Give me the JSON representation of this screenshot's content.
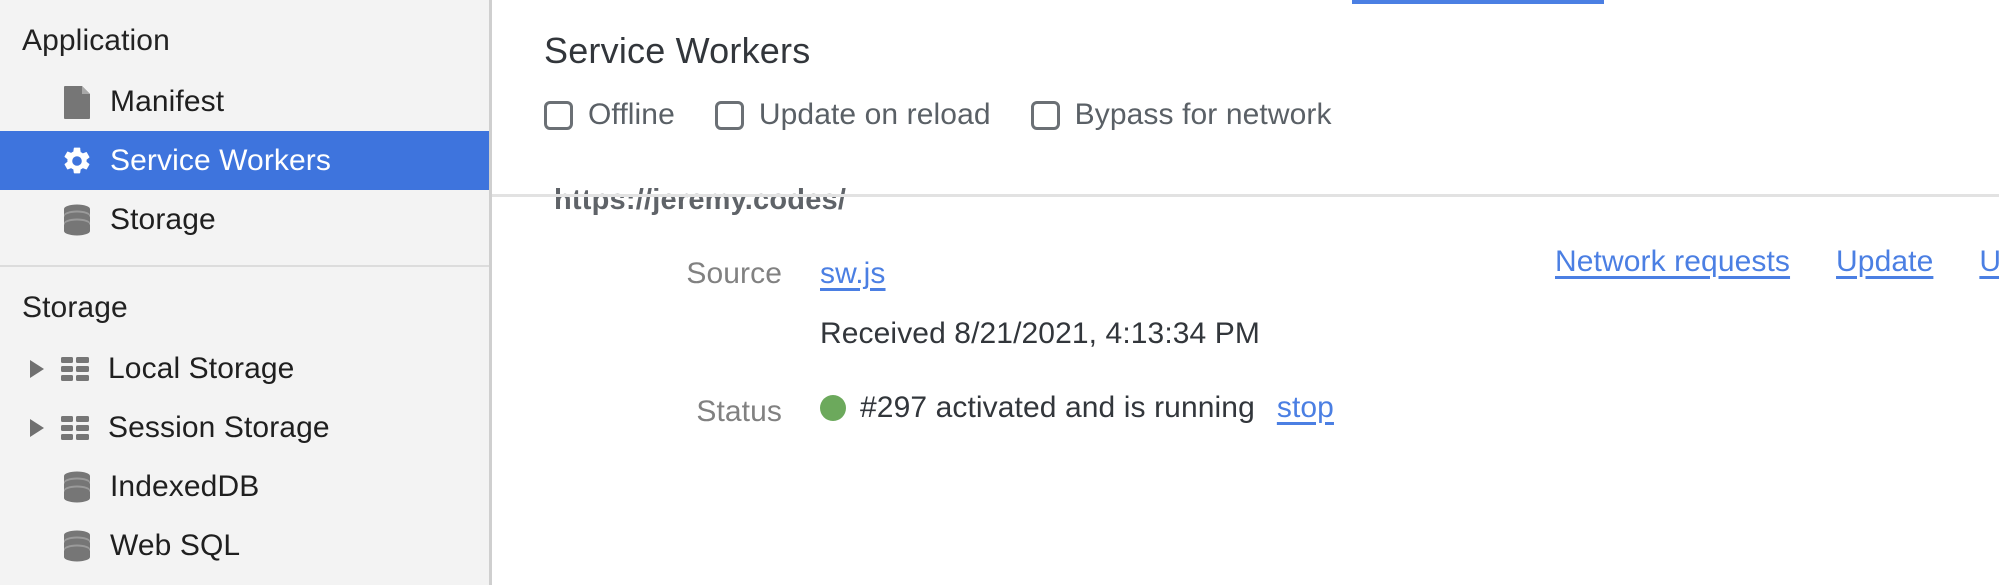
{
  "sidebar": {
    "sections": [
      {
        "title": "Application",
        "items": [
          {
            "label": "Manifest",
            "icon": "document-icon",
            "expandable": false,
            "selected": false
          },
          {
            "label": "Service Workers",
            "icon": "gear-icon",
            "expandable": false,
            "selected": true
          },
          {
            "label": "Storage",
            "icon": "database-icon",
            "expandable": false,
            "selected": false
          }
        ]
      },
      {
        "title": "Storage",
        "items": [
          {
            "label": "Local Storage",
            "icon": "table-icon",
            "expandable": true,
            "selected": false
          },
          {
            "label": "Session Storage",
            "icon": "table-icon",
            "expandable": true,
            "selected": false
          },
          {
            "label": "IndexedDB",
            "icon": "database-icon",
            "expandable": false,
            "selected": false
          },
          {
            "label": "Web SQL",
            "icon": "database-icon",
            "expandable": false,
            "selected": false
          }
        ]
      }
    ]
  },
  "main": {
    "title": "Service Workers",
    "checkboxes": [
      {
        "label": "Offline",
        "checked": false
      },
      {
        "label": "Update on reload",
        "checked": false
      },
      {
        "label": "Bypass for network",
        "checked": false
      }
    ],
    "registration": {
      "url": "https://jeremy.codes/",
      "actions": [
        {
          "label": "Network requests"
        },
        {
          "label": "Update"
        },
        {
          "label": "Unregister"
        }
      ],
      "source_label": "Source",
      "source_value": "sw.js",
      "received": "Received 8/21/2021, 4:13:34 PM",
      "status_label": "Status",
      "status_text": "#297 activated and is running",
      "status_action": "stop",
      "status_color": "#6ca95c"
    }
  },
  "colors": {
    "selection_blue": "#3e74dd",
    "link_blue": "#4b7fe3",
    "sidebar_bg": "#f3f3f3",
    "status_green": "#6ca95c"
  }
}
